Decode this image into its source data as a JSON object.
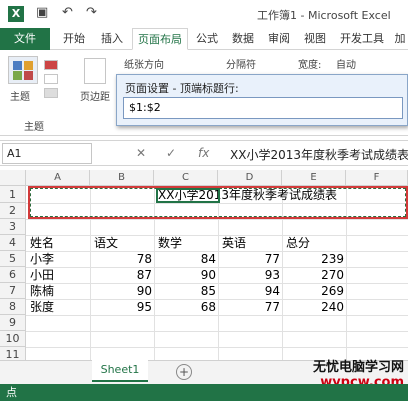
{
  "app": {
    "icon_letter": "X",
    "window_title": "工作簿1 - Microsoft Excel"
  },
  "ribbon": {
    "tabs": [
      {
        "label": "文件"
      },
      {
        "label": "开始"
      },
      {
        "label": "插入"
      },
      {
        "label": "页面布局"
      },
      {
        "label": "公式"
      },
      {
        "label": "数据"
      },
      {
        "label": "审阅"
      },
      {
        "label": "视图"
      },
      {
        "label": "开发工具"
      },
      {
        "label": "加"
      }
    ],
    "active_tab": "页面布局",
    "items": {
      "theme_label": "主题",
      "orientation_label": "纸张方向",
      "breaks_label": "分隔符",
      "width_label": "宽度:",
      "width_value": "自动",
      "margins_label": "页边距",
      "group_label": "主题"
    }
  },
  "dialog": {
    "title": "页面设置 - 顶端标题行:",
    "value": "$1:$2"
  },
  "formula_bar": {
    "name_box": "A1",
    "cancel_icon": "✕",
    "enter_icon": "✓",
    "fx_label": "fx",
    "content": "XX小学2013年度秋季考试成绩表"
  },
  "sheet": {
    "columns": [
      "A",
      "B",
      "C",
      "D",
      "E",
      "F"
    ],
    "rows": [
      "1",
      "2",
      "3",
      "4",
      "5",
      "6",
      "7",
      "8",
      "9",
      "10",
      "11"
    ],
    "title": "XX小学2013年度秋季考试成绩表",
    "headers": [
      "姓名",
      "语文",
      "数学",
      "英语",
      "总分"
    ],
    "data": [
      [
        "小李",
        "78",
        "84",
        "77",
        "239"
      ],
      [
        "小田",
        "87",
        "90",
        "93",
        "270"
      ],
      [
        "陈楠",
        "90",
        "85",
        "94",
        "269"
      ],
      [
        "张度",
        "95",
        "68",
        "77",
        "240"
      ]
    ]
  },
  "sheet_tabs": {
    "active": "Sheet1",
    "add_label": "+"
  },
  "status": {
    "mode": "点"
  },
  "watermark": {
    "line1": "无忧电脑学习网",
    "line2": "wypcw.com"
  },
  "colors": {
    "accent": "#217346",
    "selection_red": "#d23a3a"
  }
}
